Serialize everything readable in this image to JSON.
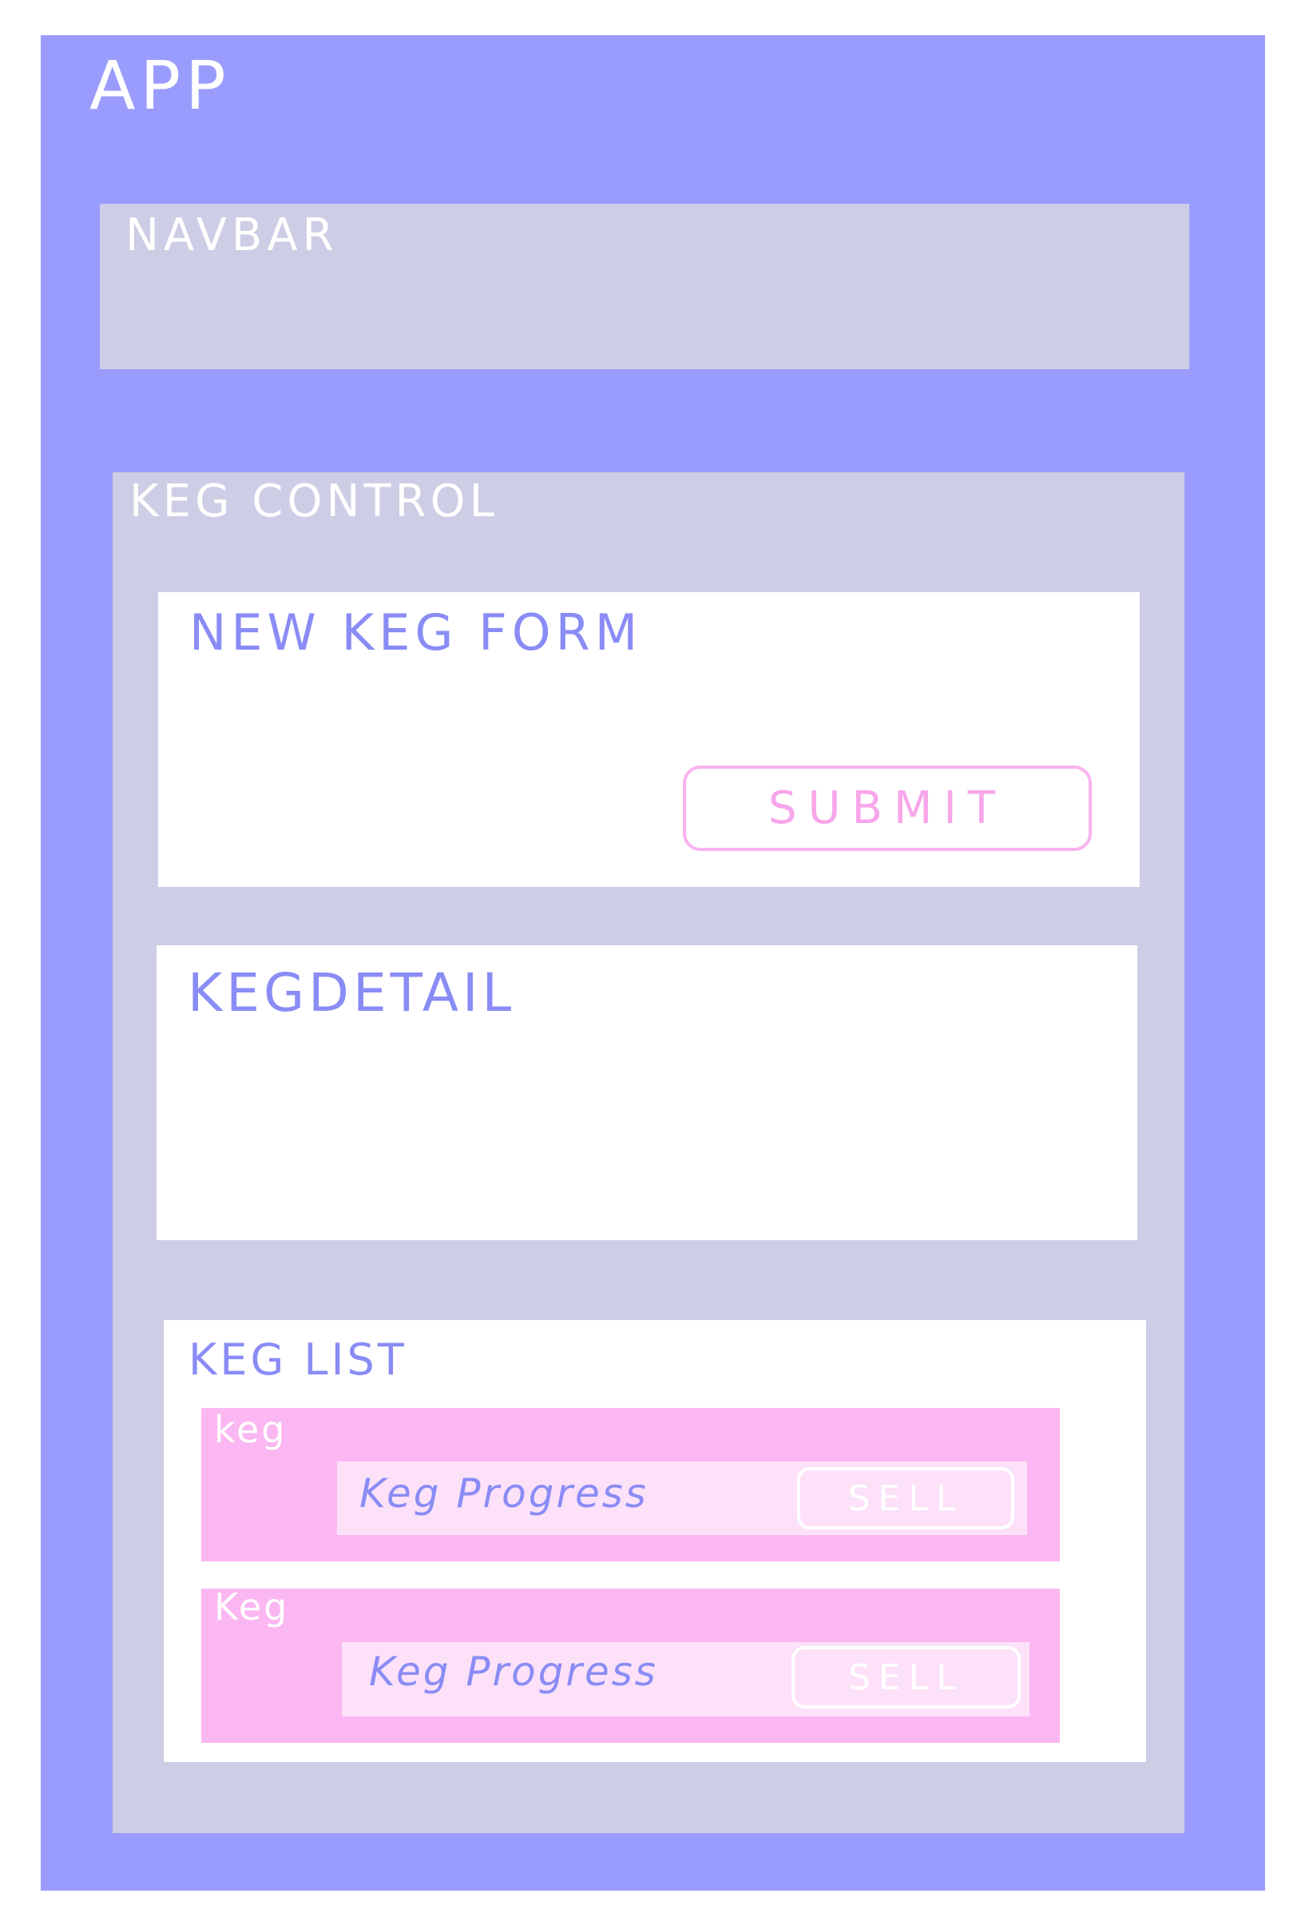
{
  "app": {
    "label": "APP"
  },
  "navbar": {
    "label": "NAVBAR"
  },
  "keg_control": {
    "label": "KEG CONTROL",
    "new_keg_form": {
      "label": "NEW KEG FORM",
      "submit_label": "SUBMIT"
    },
    "keg_detail": {
      "label": "KEGDETAIL"
    },
    "keg_list": {
      "label": "KEG LIST",
      "kegs": [
        {
          "label": "keg",
          "progress_label": "Keg Progress",
          "sell_label": "SELL"
        },
        {
          "label": "Keg",
          "progress_label": "Keg Progress",
          "sell_label": "SELL"
        }
      ]
    }
  },
  "colors": {
    "app": "#9a9cfd",
    "container": "#cdcde5",
    "panel": "#ffffff",
    "keg": "#fbb7f1",
    "progress": "#fce1f9",
    "text_accent": "#8a8cf5",
    "submit_outline": "#f8b3ee"
  }
}
